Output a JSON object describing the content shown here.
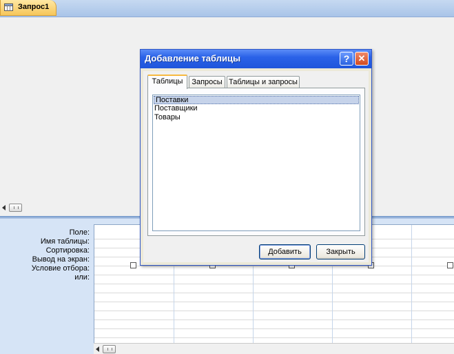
{
  "document_tab": {
    "label": "Запрос1",
    "icon": "query-icon"
  },
  "design_grid": {
    "row_labels": [
      "Поле:",
      "Имя таблицы:",
      "Сортировка:",
      "Вывод на экран:",
      "Условие отбора:",
      "или:"
    ]
  },
  "dialog": {
    "title": "Добавление таблицы",
    "help_label": "?",
    "close_label": "✕",
    "tabs": [
      {
        "label": "Таблицы",
        "active": true
      },
      {
        "label": "Запросы",
        "active": false
      },
      {
        "label": "Таблицы и запросы",
        "active": false
      }
    ],
    "items": [
      "Поставки",
      "Поставщики",
      "Товары"
    ],
    "selected_item": "Поставки",
    "buttons": {
      "add": "Добавить",
      "close": "Закрыть"
    }
  },
  "colors": {
    "titlebar": "#2a62e8",
    "active_tab_accent": "#f7b93e",
    "lower_pane": "#d6e4f6"
  }
}
